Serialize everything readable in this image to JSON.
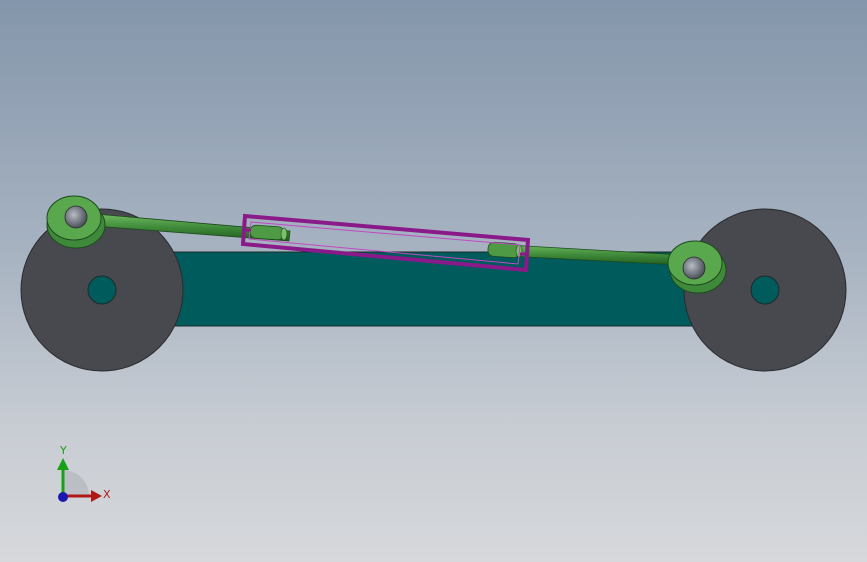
{
  "viewport": {
    "background_top": "#8496ab",
    "background_bottom": "#d6d8db"
  },
  "model": {
    "colors": {
      "wheel": "#47494f",
      "wheel_hub": "#005c5c",
      "chassis": "#005c5c",
      "rod": "#3f8a3a",
      "rod_end": "#4f9a45",
      "slider_frame": "#8a1a8a"
    }
  },
  "triad": {
    "x_label": "X",
    "y_label": "Y",
    "x_color": "#b01818",
    "y_color": "#18a018",
    "z_color": "#1818b0"
  }
}
